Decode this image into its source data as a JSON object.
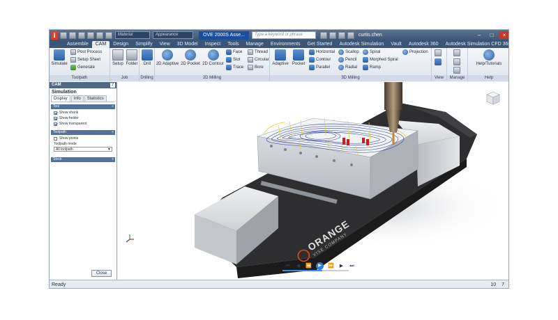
{
  "titlebar": {
    "material_placeholder": "Material",
    "appearance_placeholder": "Appearance",
    "document_title": "OVE 2000S Asse...",
    "search_placeholder": "Type a keyword or phrase",
    "user_name": "curtis.chen"
  },
  "tabs": [
    "Assemble",
    "CAM",
    "Design",
    "Simplify",
    "View",
    "3D Model",
    "Inspect",
    "Tools",
    "Manage",
    "Environments",
    "Get Started",
    "Autodesk Simulation",
    "Vault",
    "Autodesk 360",
    "Autodesk Simulation CFD 360 2014"
  ],
  "active_tab": "CAM",
  "ribbon": {
    "toolpath": {
      "title": "Toolpath",
      "simulate": "Simulate",
      "post_process": "Post Process",
      "setup_sheet": "Setup Sheet",
      "generate": "Generate"
    },
    "job": {
      "title": "Job",
      "setup": "Setup",
      "folder": "Folder"
    },
    "drilling": {
      "title": "Drilling",
      "drill": "Drill"
    },
    "milling_2d": {
      "title": "2D Milling",
      "adaptive": "2D Adaptive",
      "pocket": "2D Pocket",
      "contour": "2D Contour",
      "face": "Face",
      "slot": "Slot",
      "trace": "Trace",
      "thread": "Thread",
      "circular": "Circular",
      "bore": "Bore"
    },
    "milling_3d": {
      "title": "3D Milling",
      "adaptive": "Adaptive",
      "pocket": "Pocket",
      "horizontal": "Horizontal",
      "contour": "Contour",
      "parallel": "Parallel",
      "scallop": "Scallop",
      "pencil": "Pencil",
      "radial": "Radial",
      "spiral": "Spiral",
      "morphed_spiral": "Morphed Spiral",
      "ramp": "Ramp",
      "projection": "Projection"
    },
    "view": {
      "title": "View"
    },
    "manage": {
      "title": "Manage"
    },
    "help": {
      "title": "Help",
      "help_tutorials": "Help/Tutorials"
    }
  },
  "browser": {
    "header": "CAM",
    "title": "Simulation",
    "tabs": [
      "Display",
      "Info",
      "Statistics"
    ],
    "tool_group": "Tool",
    "tool_options": [
      {
        "label": "Show shank",
        "checked": true
      },
      {
        "label": "Show holder",
        "checked": true
      },
      {
        "label": "Show transparent",
        "checked": true
      }
    ],
    "toolpath_group": "Toolpath",
    "show_points": "Show points",
    "toolpath_mode_label": "Toolpath mode",
    "toolpath_mode_value": "All toolpath",
    "stock_group": "Stock",
    "close_label": "Close"
  },
  "viewport": {
    "vise_brand": "ORANGE",
    "vise_subtitle": "VISE COMPANY"
  },
  "status": {
    "text": "Ready",
    "count_a": "10",
    "count_b": "7"
  },
  "colors": {
    "accent": "#2f7fd8",
    "title_bar": "#3e5573",
    "vise_body": "#2b2b2b",
    "jaw": "#d9dadc",
    "toolpath_blue": "#2c3f9e",
    "toolpath_yellow": "#e3d21e",
    "feature_red": "#d11b1b"
  }
}
